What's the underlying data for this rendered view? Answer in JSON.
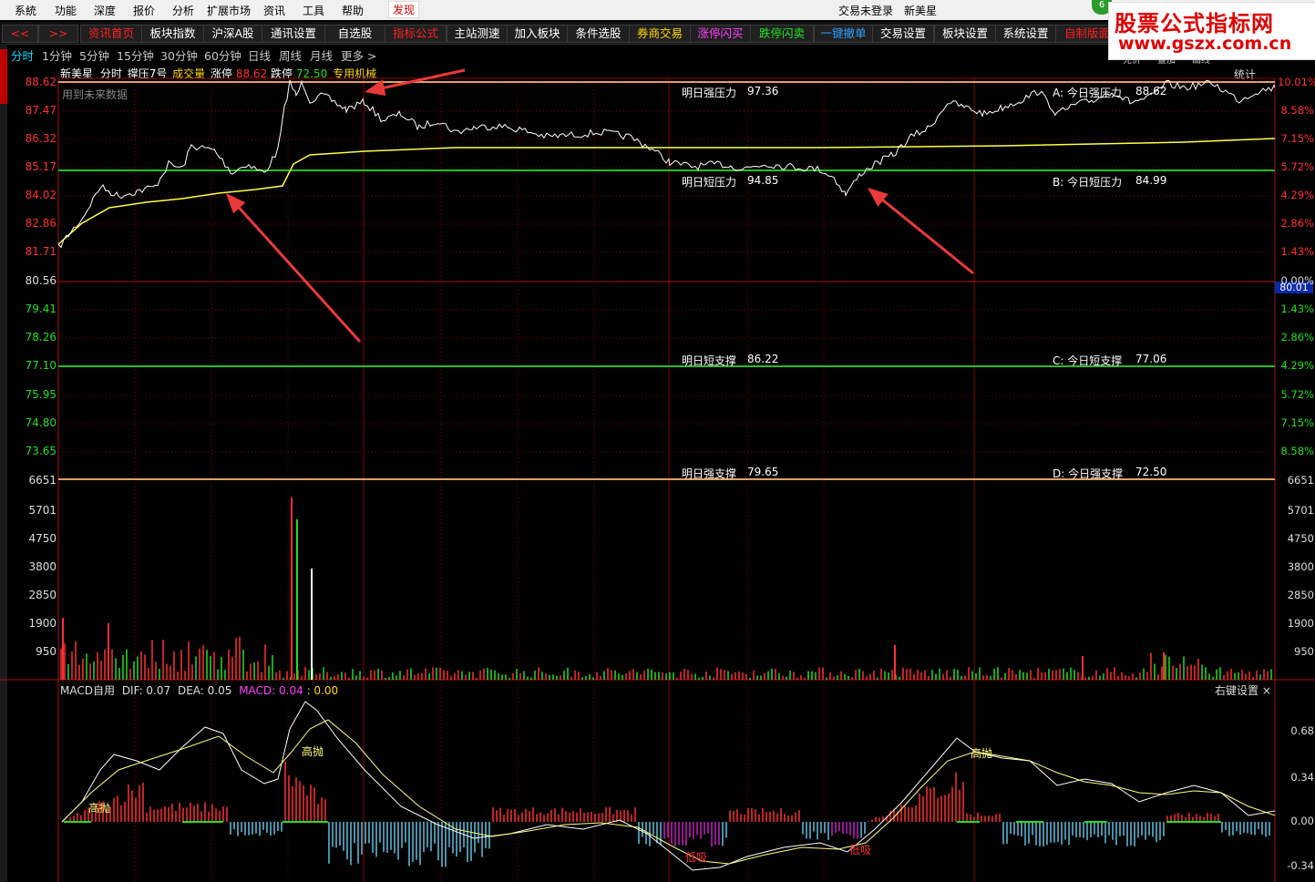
{
  "menubar": {
    "items": [
      "系統",
      "功能",
      "深度",
      "报价",
      "分析",
      "扩展市场",
      "资讯",
      "工具",
      "帮助"
    ],
    "discover": "发现",
    "trade_status": "交易未登录",
    "stock_name": "新美星",
    "badge": "6"
  },
  "toolbar": {
    "nav_back": "<<",
    "nav_forward": ">>",
    "buttons": [
      {
        "label": "资讯首页",
        "color": "red"
      },
      {
        "label": "板块指数",
        "color": "white"
      },
      {
        "label": "沪深A股",
        "color": "white"
      },
      {
        "label": "通讯设置",
        "color": "white"
      },
      {
        "label": "自选股",
        "color": "white"
      },
      {
        "label": "指标公式",
        "color": "red"
      },
      {
        "label": "主站测速",
        "color": "white"
      },
      {
        "label": "加入板块",
        "color": "white"
      },
      {
        "label": "条件选股",
        "color": "white"
      },
      {
        "label": "券商交易",
        "color": "yellow"
      },
      {
        "label": "涨停闪买",
        "color": "magenta"
      },
      {
        "label": "跌停闪卖",
        "color": "green"
      },
      {
        "label": "一键撤单",
        "color": "blue"
      },
      {
        "label": "交易设置",
        "color": "white"
      },
      {
        "label": "板块设置",
        "color": "white"
      },
      {
        "label": "系统设置",
        "color": "white"
      },
      {
        "label": "自制版面",
        "color": "red"
      }
    ]
  },
  "periods": [
    "分时",
    "1分钟",
    "5分钟",
    "15分钟",
    "30分钟",
    "60分钟",
    "日线",
    "周线",
    "月线",
    "更多 >"
  ],
  "header": {
    "name": "新美星",
    "mode": "分时",
    "indicator": "撑压7号",
    "volume_label": "成交量",
    "limit_up_label": "涨停",
    "limit_up": "88.62",
    "limit_down_label": "跌停",
    "limit_down": "72.50",
    "sector": "专用机械",
    "stats": "统计",
    "note": "用到未来数据"
  },
  "logo": {
    "line1": "股票公式指标网",
    "line2": "www.gszx.com.cn"
  },
  "right_small_buttons": [
    "兑价",
    "叠加",
    "画线"
  ],
  "price_axis": {
    "left": [
      "88.62",
      "87.47",
      "86.32",
      "85.17",
      "84.02",
      "82.86",
      "81.71",
      "80.56",
      "79.41",
      "78.26",
      "77.10",
      "75.95",
      "74.80",
      "73.65"
    ],
    "right": [
      "10.01%",
      "8.58%",
      "7.15%",
      "5.72%",
      "4.29%",
      "2.86%",
      "1.43%",
      "0.00%",
      "1.43%",
      "2.86%",
      "4.29%",
      "5.72%",
      "7.15%",
      "8.58%"
    ],
    "current_price_tag": "80.01"
  },
  "levels": {
    "tomorrow_strong_pressure": {
      "label": "明日强压力",
      "value": "97.36"
    },
    "today_strong_pressure": {
      "label": "A: 今日强压力",
      "value": "88.62"
    },
    "tomorrow_short_pressure": {
      "label": "明日短压力",
      "value": "94.85"
    },
    "today_short_pressure": {
      "label": "B: 今日短压力",
      "value": "84.99"
    },
    "tomorrow_short_support": {
      "label": "明日短支撑",
      "value": "86.22"
    },
    "today_short_support": {
      "label": "C: 今日短支撑",
      "value": "77.06"
    },
    "tomorrow_strong_support": {
      "label": "明日强支撑",
      "value": "79.65"
    },
    "today_strong_support": {
      "label": "D: 今日强支撑",
      "value": "72.50"
    }
  },
  "volume_axis": [
    "6651",
    "5701",
    "4750",
    "3800",
    "2850",
    "1900",
    "950"
  ],
  "macd": {
    "title": "MACD自用",
    "dif_label": "DIF: 0.07",
    "dea_label": "DEA: 0.05",
    "macd_label": "MACD: 0.04",
    "extra": ": 0.00",
    "right_setting": "右键设置 ×",
    "axis": [
      "0.68",
      "0.34",
      "0.00",
      "-0.34"
    ],
    "signals": [
      {
        "text": "高抛",
        "color": "#ffff80"
      },
      {
        "text": "高抛",
        "color": "#ffff80"
      },
      {
        "text": "低吸",
        "color": "#ff3030"
      },
      {
        "text": "低吸",
        "color": "#ff3030"
      },
      {
        "text": "高抛",
        "color": "#ffff80"
      }
    ]
  },
  "colors": {
    "up": "#ff3030",
    "down": "#20e020",
    "price_line": "#ffffff",
    "avg_line": "#ffff40",
    "strong_line": "#e0a060",
    "short_line": "#20c020",
    "grid": "#8b0000",
    "arrow": "#e83a3a"
  }
}
